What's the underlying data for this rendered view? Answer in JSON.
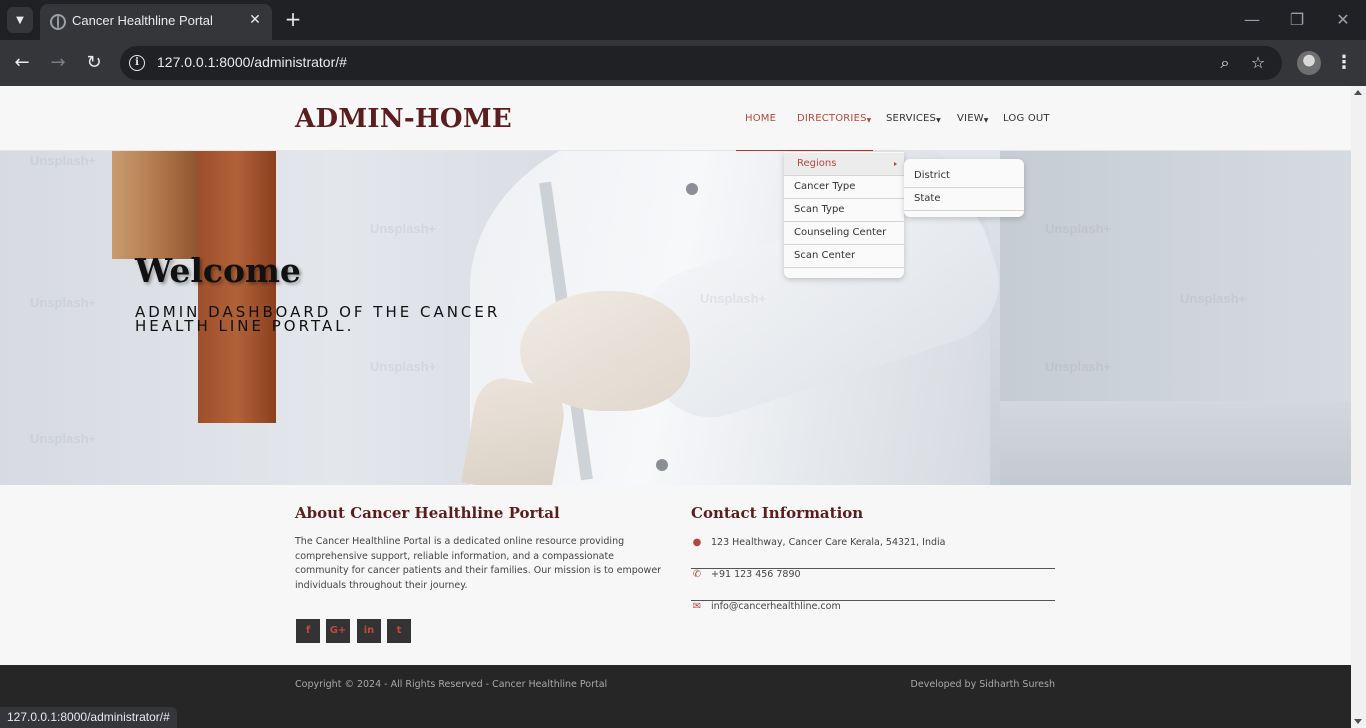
{
  "browser": {
    "tab_title": "Cancer Healthline Portal",
    "tab_close_glyph": "✕",
    "new_tab_glyph": "+",
    "url": "127.0.0.1:8000/administrator/#",
    "status_url": "127.0.0.1:8000/administrator/#",
    "window_buttons": {
      "minimize": "—",
      "restore": "❐",
      "close": "✕"
    },
    "icons": [
      "tab-search-icon",
      "back-arrow-icon",
      "forward-arrow-icon",
      "reload-icon",
      "site-info-icon",
      "zoom-icon",
      "bookmark-star-icon",
      "profile-avatar-icon",
      "more-menu-icon"
    ]
  },
  "site": {
    "brand": "ADMIN-HOME",
    "nav": [
      {
        "label": "HOME",
        "active": true
      },
      {
        "label": "DIRECTORIES",
        "dropdown": true
      },
      {
        "label": "SERVICES",
        "dropdown": true
      },
      {
        "label": "VIEW",
        "dropdown": true
      },
      {
        "label": "LOG OUT"
      }
    ],
    "directories_menu": [
      "Regions",
      "Cancer Type",
      "Scan Type",
      "Counseling Center",
      "Scan Center"
    ],
    "regions_submenu": [
      "District",
      "State"
    ]
  },
  "hero": {
    "title": "Welcome",
    "subtitle": "Admin dashboard of the cancer health line portal.",
    "watermark": "Unsplash+"
  },
  "about": {
    "title": "About Cancer Healthline Portal",
    "text": "The Cancer Healthline Portal is a dedicated online resource providing comprehensive support, reliable information, and a compassionate community for cancer patients and their families. Our mission is to empower individuals throughout their journey.",
    "social": [
      {
        "icon": "facebook-icon",
        "glyph": "f"
      },
      {
        "icon": "google-plus-icon",
        "glyph": "G+"
      },
      {
        "icon": "linkedin-icon",
        "glyph": "in"
      },
      {
        "icon": "twitter-icon",
        "glyph": "t"
      }
    ]
  },
  "contact": {
    "title": "Contact Information",
    "address": "123 Healthway, Cancer Care Kerala, 54321, India",
    "phone": "+91 123 456 7890",
    "email": "info@cancerhealthline.com"
  },
  "footer": {
    "copyright": "Copyright © 2024 - All Rights Reserved - Cancer Healthline Portal",
    "developer": "Developed by Sidharth Suresh"
  },
  "colors": {
    "brand": "#5a1e1e",
    "accent": "#b04a3f",
    "footer_bg": "#262626"
  }
}
